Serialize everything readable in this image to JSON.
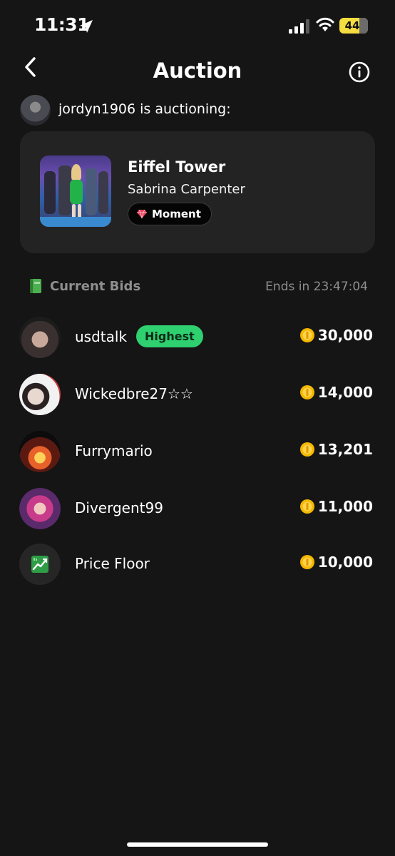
{
  "status_bar": {
    "time": "11:31",
    "battery": "44"
  },
  "header": {
    "title": "Auction"
  },
  "seller": {
    "text": "jordyn1906 is auctioning:"
  },
  "item": {
    "title": "Eiffel Tower",
    "artist": "Sabrina Carpenter",
    "badge": "Moment"
  },
  "bids_section": {
    "label": "Current Bids",
    "ends": "Ends in 23:47:04"
  },
  "bids": [
    {
      "name": "usdtalk",
      "badge": "Highest",
      "amount": "30,000"
    },
    {
      "name": "Wickedbre27☆☆",
      "amount": "14,000"
    },
    {
      "name": "Furrymario",
      "amount": "13,201"
    },
    {
      "name": "Divergent99",
      "amount": "11,000"
    },
    {
      "name": "Price Floor",
      "amount": "10,000"
    }
  ],
  "colors": {
    "background": "#151515",
    "card": "#232323",
    "highest_badge": "#2ed070",
    "coin": "#f5b800",
    "battery": "#f6dd3f"
  }
}
